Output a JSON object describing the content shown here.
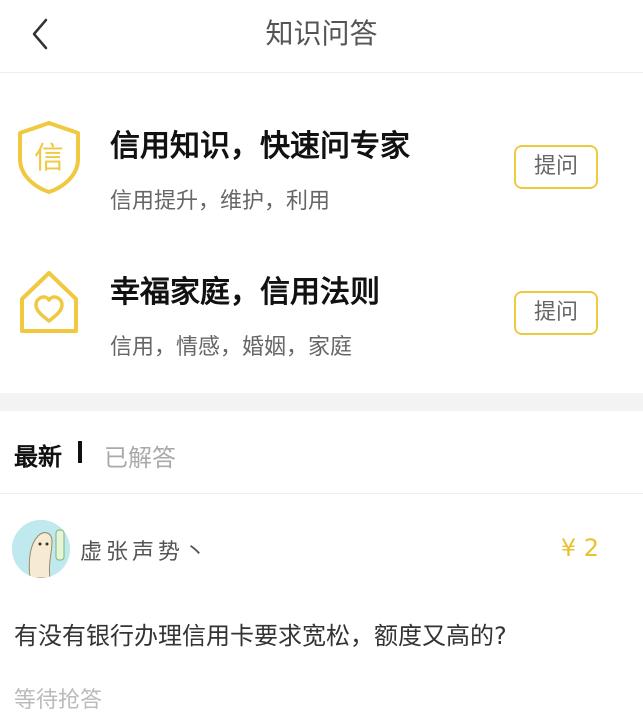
{
  "header": {
    "title": "知识问答",
    "back_icon": "chevron-left-icon"
  },
  "categories": [
    {
      "title": "信用知识，快速问专家",
      "subtitle": "信用提升，维护，利用",
      "icon": "shield-credit-icon",
      "icon_text": "信",
      "button_label": "提问"
    },
    {
      "title": "幸福家庭，信用法则",
      "subtitle": "信用，情感，婚姻，家庭",
      "icon": "house-heart-icon",
      "button_label": "提问"
    }
  ],
  "tabs": {
    "active": "最新",
    "inactive": "已解答"
  },
  "question": {
    "username": "虚张声势丶",
    "reward": "¥ 2",
    "text": "有没有银行办理信用卡要求宽松，额度又高的?",
    "status": "等待抢答"
  },
  "colors": {
    "accent": "#f0c940",
    "reward": "#e9c230",
    "separator": "#f3f3f3"
  }
}
